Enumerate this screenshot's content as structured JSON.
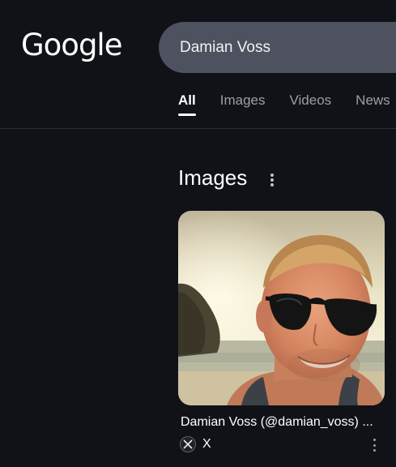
{
  "header": {
    "logo_text": "Google",
    "search_value": "Damian Voss"
  },
  "tabs": [
    {
      "label": "All",
      "active": true
    },
    {
      "label": "Images",
      "active": false
    },
    {
      "label": "Videos",
      "active": false
    },
    {
      "label": "News",
      "active": false
    }
  ],
  "images_section": {
    "title": "Images",
    "result": {
      "title": "Damian Voss (@damian_voss) ...",
      "source": "X",
      "source_icon": "x-logo-icon"
    }
  },
  "colors": {
    "background": "#101218",
    "search_box": "#4d5160",
    "text_primary": "#ffffff",
    "text_secondary": "#9aa0a6"
  }
}
